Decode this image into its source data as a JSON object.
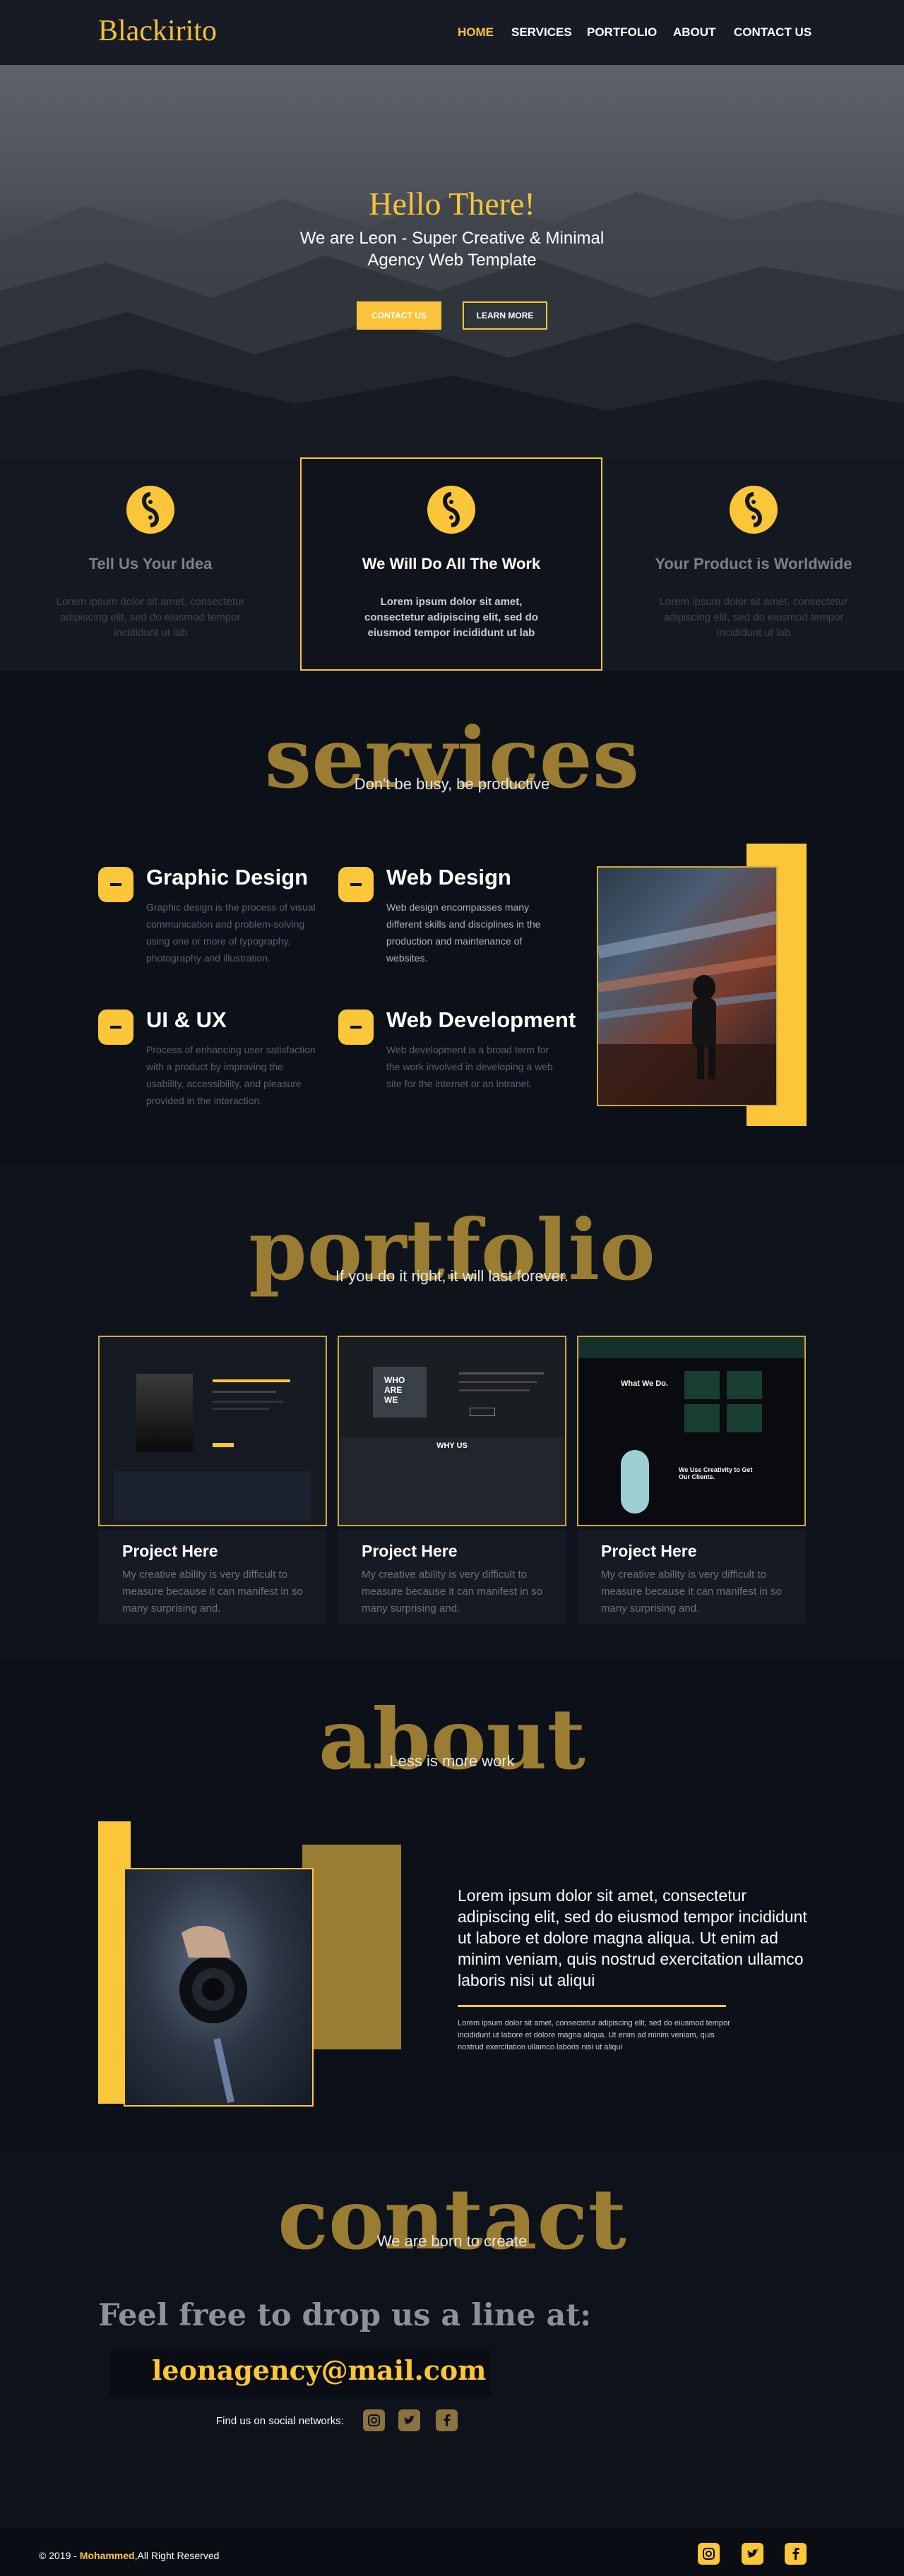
{
  "nav": {
    "logo": "Blackirito",
    "links": [
      "HOME",
      "SERVICES",
      "PORTFOLIO",
      "ABOUT",
      "CONTACT US"
    ],
    "active_color": "#fcc63a"
  },
  "hero": {
    "title": "Hello There!",
    "subtitle": "We are Leon - Super Creative & Minimal Agency  Web Template",
    "btn_contact": "CONTACT US",
    "btn_learn": "LEARN MORE"
  },
  "features": [
    {
      "title": "Tell Us Your Idea",
      "text": "Lorem ipsum dolor sit amet, consectetur adipiscing elit, sed do eiusmod tempor incididunt ut lab"
    },
    {
      "title": "We Will Do All The Work",
      "text": "Lorem ipsum dolor sit amet, consectetur adipiscing elit, sed do eiusmod tempor incididunt ut lab"
    },
    {
      "title": "Your Product is Worldwide",
      "text": "Lorem ipsum dolor sit amet, consectetur adipiscing elit, sed do eiusmod tempor incididunt ut lab"
    }
  ],
  "services": {
    "title": "services",
    "subtitle": "Don't be busy, be productive",
    "items": [
      {
        "title": "Graphic Design",
        "text": "Graphic design is the process of visual communication and problem-solving using one or more of typography, photography and illustration."
      },
      {
        "title": "Web Design",
        "text": "Web design encompasses many different skills and disciplines in the production and maintenance of websites."
      },
      {
        "title": "UI & UX",
        "text": "Process of enhancing user satisfaction with a product by improving the usability, accessibility, and pleasure provided in the interaction."
      },
      {
        "title": "Web Development",
        "text": "Web development is a broad term for the work involved in developing a web site for the internet or an intranet."
      }
    ]
  },
  "portfolio": {
    "title": "portfolio",
    "subtitle": "If you do it right, it will last forever.",
    "items": [
      {
        "title": "Project Here",
        "text": "My creative ability is very difficult to measure because it can manifest in so many surprising and."
      },
      {
        "title": "Project Here",
        "text": "My creative ability is very difficult to measure because it can manifest in so many surprising and."
      },
      {
        "title": "Project Here",
        "text": "My creative ability is very difficult to measure because it can manifest in so many surprising and."
      }
    ],
    "thumb2_words": [
      "WHO",
      "ARE",
      "WE"
    ],
    "thumb2_why": "WHY US",
    "thumb3_heading": "What We Do.",
    "thumb3_heading2": "We Use Creativity to Get Our Clients."
  },
  "about": {
    "title": "about",
    "subtitle": "Less is more work",
    "lead": "Lorem ipsum dolor sit amet, consectetur adipiscing elit, sed do eiusmod tempor incididunt ut labore et dolore magna aliqua. Ut enim ad minim veniam, quis nostrud exercitation ullamco laboris nisi ut aliqui",
    "small": "Lorem ipsum dolor sit amet, consectetur adipiscing elit, sed do eiusmod tempor incididunt ut labore et dolore magna aliqua. Ut enim ad minim veniam, quis nostrud exercitation ullamco laboris nisi ut aliqui"
  },
  "contact": {
    "title": "contact",
    "subtitle": "We are born to create",
    "drop": "Feel free to drop us a line at:",
    "email": "leonagency@mail.com",
    "social_label": "Find us on social networks:",
    "social_icons": [
      "instagram-icon",
      "twitter-icon",
      "facebook-icon"
    ]
  },
  "footer": {
    "copy_prefix": "© 2019 - ",
    "author": "Mohammed",
    "copy_suffix": ",All Right Reserved"
  },
  "colors": {
    "accent": "#fcc63a",
    "background": "#0c1019",
    "heading_gold": "#9a7d32"
  }
}
